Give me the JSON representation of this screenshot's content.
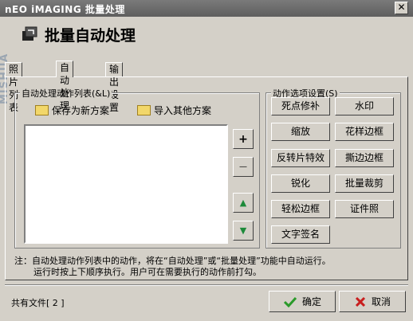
{
  "window": {
    "title": "nEO iMAGING 批量处理",
    "close_glyph": "✕"
  },
  "header": {
    "title": "批量自动处理",
    "watermark": "MISHUA"
  },
  "tabs": [
    {
      "label": "照片列表",
      "active": false
    },
    {
      "label": "自动处理",
      "active": true
    },
    {
      "label": "输出设置",
      "active": false
    }
  ],
  "actions_group": {
    "label": "自动处理动作列表(&L)",
    "save_new": "保存为新方案",
    "import_other": "导入其他方案",
    "side_buttons": {
      "add": "+",
      "remove": "—",
      "up": "▲",
      "down": "▼"
    }
  },
  "options_group": {
    "label": "动作选项设置(S)",
    "buttons": [
      "死点修补",
      "水印",
      "缩放",
      "花样边框",
      "反转片特效",
      "撕边边框",
      "锐化",
      "批量裁剪",
      "轻松边框",
      "证件照",
      "文字签名"
    ]
  },
  "note": {
    "line1": "注：自动处理动作列表中的动作，将在“自动处理”或“批量处理”功能中自动运行。",
    "line2": "运行时按上下顺序执行。用户可在需要执行的动作前打勾。"
  },
  "status": {
    "file_count": "共有文件[ 2 ]"
  },
  "footer": {
    "ok": "确定",
    "cancel": "取消"
  },
  "colors": {
    "ok_check": "#2a9a2a",
    "cancel_x": "#c81e1e",
    "arrow": "#1d8a3a"
  }
}
